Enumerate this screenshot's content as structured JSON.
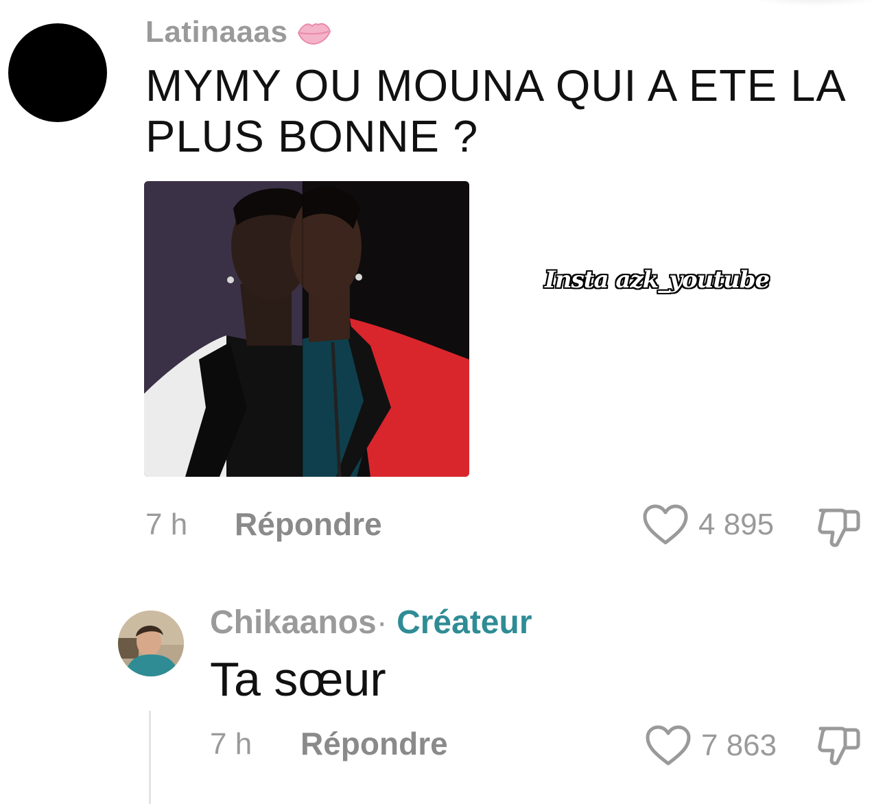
{
  "comment": {
    "username": "Latinaaas",
    "username_emoji": "lips-icon",
    "text": "MYMY OU MOUNA QUI A ETE LA PLUS BONNE ?",
    "image_watermark": "Insta azk_youtube",
    "time": "7 h",
    "reply_label": "Répondre",
    "likes": "4 895"
  },
  "reply": {
    "username": "Chikaanos",
    "separator": "·",
    "badge": "Créateur",
    "text": "Ta sœur",
    "time": "7 h",
    "reply_label": "Répondre",
    "likes": "7 863"
  },
  "colors": {
    "muted_text": "#9a9a9a",
    "creator_badge": "#2f8c95",
    "lips": "#f2a9c0"
  }
}
